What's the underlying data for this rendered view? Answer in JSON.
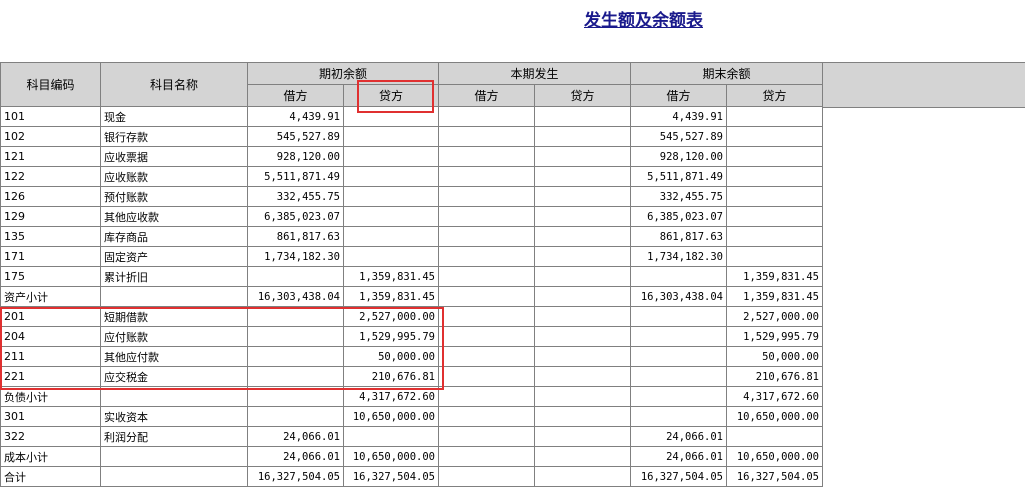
{
  "title": "发生额及余额表",
  "headers": {
    "code": "科目编码",
    "name": "科目名称",
    "opening": "期初余额",
    "period": "本期发生",
    "closing": "期末余额",
    "debit": "借方",
    "credit": "贷方"
  },
  "rows": [
    {
      "code": "101",
      "name": "现金",
      "open_dr": "4,439.91",
      "open_cr": "",
      "per_dr": "",
      "per_cr": "",
      "close_dr": "4,439.91",
      "close_cr": ""
    },
    {
      "code": "102",
      "name": "银行存款",
      "open_dr": "545,527.89",
      "open_cr": "",
      "per_dr": "",
      "per_cr": "",
      "close_dr": "545,527.89",
      "close_cr": ""
    },
    {
      "code": "121",
      "name": "应收票据",
      "open_dr": "928,120.00",
      "open_cr": "",
      "per_dr": "",
      "per_cr": "",
      "close_dr": "928,120.00",
      "close_cr": ""
    },
    {
      "code": "122",
      "name": "应收账款",
      "open_dr": "5,511,871.49",
      "open_cr": "",
      "per_dr": "",
      "per_cr": "",
      "close_dr": "5,511,871.49",
      "close_cr": ""
    },
    {
      "code": "126",
      "name": "预付账款",
      "open_dr": "332,455.75",
      "open_cr": "",
      "per_dr": "",
      "per_cr": "",
      "close_dr": "332,455.75",
      "close_cr": ""
    },
    {
      "code": "129",
      "name": "其他应收款",
      "open_dr": "6,385,023.07",
      "open_cr": "",
      "per_dr": "",
      "per_cr": "",
      "close_dr": "6,385,023.07",
      "close_cr": ""
    },
    {
      "code": "135",
      "name": "库存商品",
      "open_dr": "861,817.63",
      "open_cr": "",
      "per_dr": "",
      "per_cr": "",
      "close_dr": "861,817.63",
      "close_cr": ""
    },
    {
      "code": "171",
      "name": "固定资产",
      "open_dr": "1,734,182.30",
      "open_cr": "",
      "per_dr": "",
      "per_cr": "",
      "close_dr": "1,734,182.30",
      "close_cr": ""
    },
    {
      "code": "175",
      "name": "累计折旧",
      "open_dr": "",
      "open_cr": "1,359,831.45",
      "per_dr": "",
      "per_cr": "",
      "close_dr": "",
      "close_cr": "1,359,831.45"
    },
    {
      "code": "资产小计",
      "name": "",
      "open_dr": "16,303,438.04",
      "open_cr": "1,359,831.45",
      "per_dr": "",
      "per_cr": "",
      "close_dr": "16,303,438.04",
      "close_cr": "1,359,831.45"
    },
    {
      "code": "201",
      "name": "短期借款",
      "open_dr": "",
      "open_cr": "2,527,000.00",
      "per_dr": "",
      "per_cr": "",
      "close_dr": "",
      "close_cr": "2,527,000.00"
    },
    {
      "code": "204",
      "name": "应付账款",
      "open_dr": "",
      "open_cr": "1,529,995.79",
      "per_dr": "",
      "per_cr": "",
      "close_dr": "",
      "close_cr": "1,529,995.79"
    },
    {
      "code": "211",
      "name": "其他应付款",
      "open_dr": "",
      "open_cr": "50,000.00",
      "per_dr": "",
      "per_cr": "",
      "close_dr": "",
      "close_cr": "50,000.00"
    },
    {
      "code": "221",
      "name": "应交税金",
      "open_dr": "",
      "open_cr": "210,676.81",
      "per_dr": "",
      "per_cr": "",
      "close_dr": "",
      "close_cr": "210,676.81"
    },
    {
      "code": "负债小计",
      "name": "",
      "open_dr": "",
      "open_cr": "4,317,672.60",
      "per_dr": "",
      "per_cr": "",
      "close_dr": "",
      "close_cr": "4,317,672.60"
    },
    {
      "code": "301",
      "name": "实收资本",
      "open_dr": "",
      "open_cr": "10,650,000.00",
      "per_dr": "",
      "per_cr": "",
      "close_dr": "",
      "close_cr": "10,650,000.00"
    },
    {
      "code": "322",
      "name": "利润分配",
      "open_dr": "24,066.01",
      "open_cr": "",
      "per_dr": "",
      "per_cr": "",
      "close_dr": "24,066.01",
      "close_cr": ""
    },
    {
      "code": "成本小计",
      "name": "",
      "open_dr": "24,066.01",
      "open_cr": "10,650,000.00",
      "per_dr": "",
      "per_cr": "",
      "close_dr": "24,066.01",
      "close_cr": "10,650,000.00"
    },
    {
      "code": "合计",
      "name": "",
      "open_dr": "16,327,504.05",
      "open_cr": "16,327,504.05",
      "per_dr": "",
      "per_cr": "",
      "close_dr": "16,327,504.05",
      "close_cr": "16,327,504.05"
    }
  ],
  "highlight_color": "#e03030"
}
